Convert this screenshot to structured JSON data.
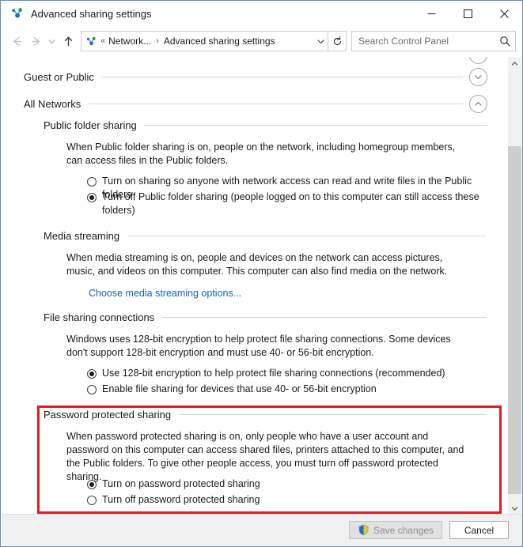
{
  "window": {
    "title": "Advanced sharing settings",
    "icon": "network-sharing-icon",
    "minimize_label": "─",
    "maximize_label": "☐",
    "close_label": "✕"
  },
  "navigation": {
    "back_icon": "arrow-left-icon",
    "forward_icon": "arrow-right-icon",
    "recent_icon": "chevron-down-icon",
    "up_icon": "arrow-up-icon",
    "refresh_icon": "refresh-icon",
    "breadcrumb": {
      "overflow": "«",
      "parent": "Network...",
      "separator": "›",
      "current": "Advanced sharing settings",
      "dropdown_icon": "chevron-down-icon"
    },
    "search": {
      "placeholder": "Search Control Panel",
      "icon": "search-icon"
    }
  },
  "profiles": [
    {
      "name": "Guest or Public",
      "expanded": false,
      "toggle_icon": "chevron-down-icon"
    },
    {
      "name": "All Networks",
      "expanded": true,
      "toggle_icon": "chevron-up-icon"
    }
  ],
  "sections": {
    "public_folder": {
      "heading": "Public folder sharing",
      "description": "When Public folder sharing is on, people on the network, including homegroup members, can access files in the Public folders.",
      "options": [
        {
          "label": "Turn on sharing so anyone with network access can read and write files in the Public folders",
          "selected": false
        },
        {
          "label": "Turn off Public folder sharing (people logged on to this computer can still access these folders)",
          "selected": true
        }
      ]
    },
    "media_streaming": {
      "heading": "Media streaming",
      "description": "When media streaming is on, people and devices on the network can access pictures, music, and videos on this computer. This computer can also find media on the network.",
      "link": "Choose media streaming options..."
    },
    "file_sharing_connections": {
      "heading": "File sharing connections",
      "description": "Windows uses 128-bit encryption to help protect file sharing connections. Some devices don't support 128-bit encryption and must use 40- or 56-bit encryption.",
      "options": [
        {
          "label": "Use 128-bit encryption to help protect file sharing connections (recommended)",
          "selected": true
        },
        {
          "label": "Enable file sharing for devices that use 40- or 56-bit encryption",
          "selected": false
        }
      ]
    },
    "password_protected_sharing": {
      "heading": "Password protected sharing",
      "description": "When password protected sharing is on, only people who have a user account and password on this computer can access shared files, printers attached to this computer, and the Public folders. To give other people access, you must turn off password protected sharing.",
      "options": [
        {
          "label": "Turn on password protected sharing",
          "selected": true
        },
        {
          "label": "Turn off password protected sharing",
          "selected": false
        }
      ],
      "highlighted": true,
      "highlight_color": "#e01b24"
    }
  },
  "footer": {
    "save_label": "Save changes",
    "save_disabled": true,
    "save_icon": "uac-shield-icon",
    "cancel_label": "Cancel"
  },
  "scrollbar": {
    "up_icon": "chevron-up-icon",
    "down_icon": "chevron-down-icon"
  },
  "colors": {
    "link": "#1464b4",
    "highlight": "#e01b24",
    "window_border": "#5b8fb9"
  }
}
